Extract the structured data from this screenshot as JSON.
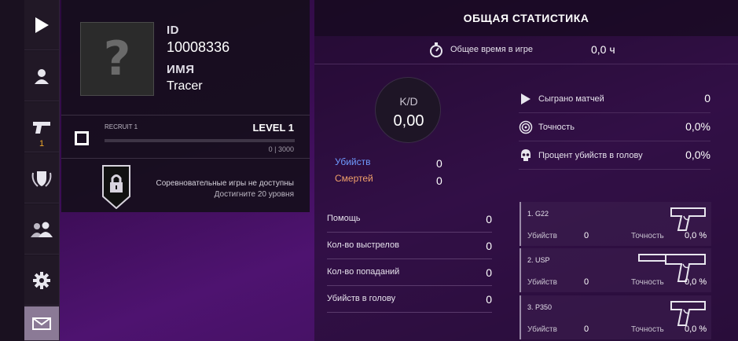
{
  "nav": {
    "items": [
      {
        "name": "play",
        "icon": "play-icon"
      },
      {
        "name": "profile",
        "icon": "person-icon"
      },
      {
        "name": "weapons",
        "icon": "pistol-icon",
        "badge": "1"
      },
      {
        "name": "clan",
        "icon": "wreath-shield-icon"
      },
      {
        "name": "friends",
        "icon": "people-icon"
      },
      {
        "name": "settings",
        "icon": "gear-icon"
      },
      {
        "name": "mail",
        "icon": "envelope-icon"
      }
    ]
  },
  "profile": {
    "avatar_glyph": "?",
    "id_label": "ID",
    "id_value": "10008336",
    "name_label": "ИМЯ",
    "name_value": "Tracer",
    "rank_name": "RECRUIT 1",
    "level": "LEVEL 1",
    "xp_text": "0 | 3000",
    "xp_progress": 0,
    "competitive_line1": "Соревновательные игры не доступны",
    "competitive_line2": "Достигните 20 уровня"
  },
  "stats": {
    "title": "ОБЩАЯ СТАТИСТИКА",
    "total_time_label": "Общее время в игре",
    "total_time_value": "0,0 ч",
    "kd_label": "K/D",
    "kd_value": "0,00",
    "kills_label": "Убийств",
    "kills_value": "0",
    "deaths_label": "Смертей",
    "deaths_value": "0",
    "right": [
      {
        "icon": "play-icon",
        "label": "Сыграно матчей",
        "value": "0"
      },
      {
        "icon": "target-icon",
        "label": "Точность",
        "value": "0,0%"
      },
      {
        "icon": "skull-icon",
        "label": "Процент убийств в голову",
        "value": "0,0%"
      }
    ],
    "left": [
      {
        "label": "Помощь",
        "value": "0"
      },
      {
        "label": "Кол-во выстрелов",
        "value": "0"
      },
      {
        "label": "Кол-во попаданий",
        "value": "0"
      },
      {
        "label": "Убийств в голову",
        "value": "0"
      }
    ],
    "weapons": [
      {
        "name": "1. G22",
        "kills_label": "Убийств",
        "kills": "0",
        "acc_label": "Точность",
        "acc": "0,0 %"
      },
      {
        "name": "2. USP",
        "kills_label": "Убийств",
        "kills": "0",
        "acc_label": "Точность",
        "acc": "0,0 %"
      },
      {
        "name": "3. P350",
        "kills_label": "Убийств",
        "kills": "0",
        "acc_label": "Точность",
        "acc": "0,0 %"
      }
    ]
  },
  "colors": {
    "kills": "#6f9bff",
    "deaths": "#f0a06a",
    "badge": "#f0a92c"
  }
}
